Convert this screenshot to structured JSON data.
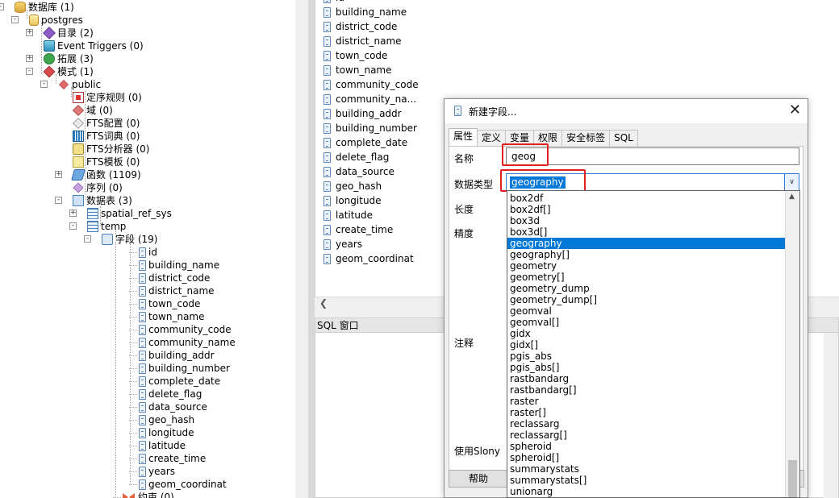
{
  "tree": {
    "nodes": [
      {
        "label": "数据库 (1)",
        "icon": "database-icon"
      },
      {
        "label": "postgres",
        "icon": "database-postgres-icon"
      },
      {
        "label": "目录 (2)",
        "icon": "catalog-icon"
      },
      {
        "label": "Event Triggers (0)",
        "icon": "event-trigger-icon"
      },
      {
        "label": "拓展 (3)",
        "icon": "extension-icon"
      },
      {
        "label": "模式 (1)",
        "icon": "schema-icon"
      },
      {
        "label": "public",
        "icon": "public-schema-icon"
      },
      {
        "label": "定序规则 (0)",
        "icon": "collation-icon"
      },
      {
        "label": "域 (0)",
        "icon": "domain-icon"
      },
      {
        "label": "FTS配置 (0)",
        "icon": "fts-config-icon"
      },
      {
        "label": "FTS词典 (0)",
        "icon": "fts-dictionary-icon"
      },
      {
        "label": "FTS分析器 (0)",
        "icon": "fts-parser-icon"
      },
      {
        "label": "FTS模板 (0)",
        "icon": "fts-template-icon"
      },
      {
        "label": "函数 (1109)",
        "icon": "function-icon"
      },
      {
        "label": "序列 (0)",
        "icon": "sequence-icon"
      },
      {
        "label": "数据表 (3)",
        "icon": "tables-icon"
      },
      {
        "label": "spatial_ref_sys",
        "icon": "table-icon"
      },
      {
        "label": "temp",
        "icon": "table-icon"
      },
      {
        "label": "字段 (19)",
        "icon": "columns-icon"
      },
      {
        "label": "id",
        "icon": "column-icon"
      },
      {
        "label": "building_name",
        "icon": "column-icon"
      },
      {
        "label": "district_code",
        "icon": "column-icon"
      },
      {
        "label": "district_name",
        "icon": "column-icon"
      },
      {
        "label": "town_code",
        "icon": "column-icon"
      },
      {
        "label": "town_name",
        "icon": "column-icon"
      },
      {
        "label": "community_code",
        "icon": "column-icon"
      },
      {
        "label": "community_name",
        "icon": "column-icon"
      },
      {
        "label": "building_addr",
        "icon": "column-icon"
      },
      {
        "label": "building_number",
        "icon": "column-icon"
      },
      {
        "label": "complete_date",
        "icon": "column-icon"
      },
      {
        "label": "delete_flag",
        "icon": "column-icon"
      },
      {
        "label": "data_source",
        "icon": "column-icon"
      },
      {
        "label": "geo_hash",
        "icon": "column-icon"
      },
      {
        "label": "longitude",
        "icon": "column-icon"
      },
      {
        "label": "latitude",
        "icon": "column-icon"
      },
      {
        "label": "create_time",
        "icon": "column-icon"
      },
      {
        "label": "years",
        "icon": "column-icon"
      },
      {
        "label": "geom_coordinat",
        "icon": "column-icon"
      },
      {
        "label": "约束 (0)",
        "icon": "constraint-icon"
      }
    ]
  },
  "field_list": {
    "items": [
      "id",
      "building_name",
      "district_code",
      "district_name",
      "town_code",
      "town_name",
      "community_code",
      "community_na...",
      "building_addr",
      "building_number",
      "complete_date",
      "delete_flag",
      "data_source",
      "geo_hash",
      "longitude",
      "latitude",
      "create_time",
      "years",
      "geom_coordinat"
    ]
  },
  "sql_window": {
    "title": "SQL 窗口"
  },
  "dialog": {
    "title": "新建字段...",
    "close": "✕",
    "tabs": [
      "属性",
      "定义",
      "变量",
      "权限",
      "安全标签",
      "SQL"
    ],
    "labels": {
      "name": "名称",
      "data_type": "数据类型",
      "length": "长度",
      "precision": "精度",
      "comment": "注释",
      "use_slony": "使用Slony"
    },
    "name_value": "geog",
    "data_type_value": "geography",
    "help_button": "帮助"
  },
  "dropdown": {
    "options": [
      "box2df",
      "box2df[]",
      "box3d",
      "box3d[]",
      "geography",
      "geography[]",
      "geometry",
      "geometry[]",
      "geometry_dump",
      "geometry_dump[]",
      "geomval",
      "geomval[]",
      "gidx",
      "gidx[]",
      "pgis_abs",
      "pgis_abs[]",
      "rastbandarg",
      "rastbandarg[]",
      "raster",
      "raster[]",
      "reclassarg",
      "reclassarg[]",
      "spheroid",
      "spheroid[]",
      "summarystats",
      "summarystats[]",
      "unionarg"
    ],
    "selected": "geography"
  },
  "colors": {
    "selection": "#0078d7",
    "highlight_box": "#e02020"
  }
}
